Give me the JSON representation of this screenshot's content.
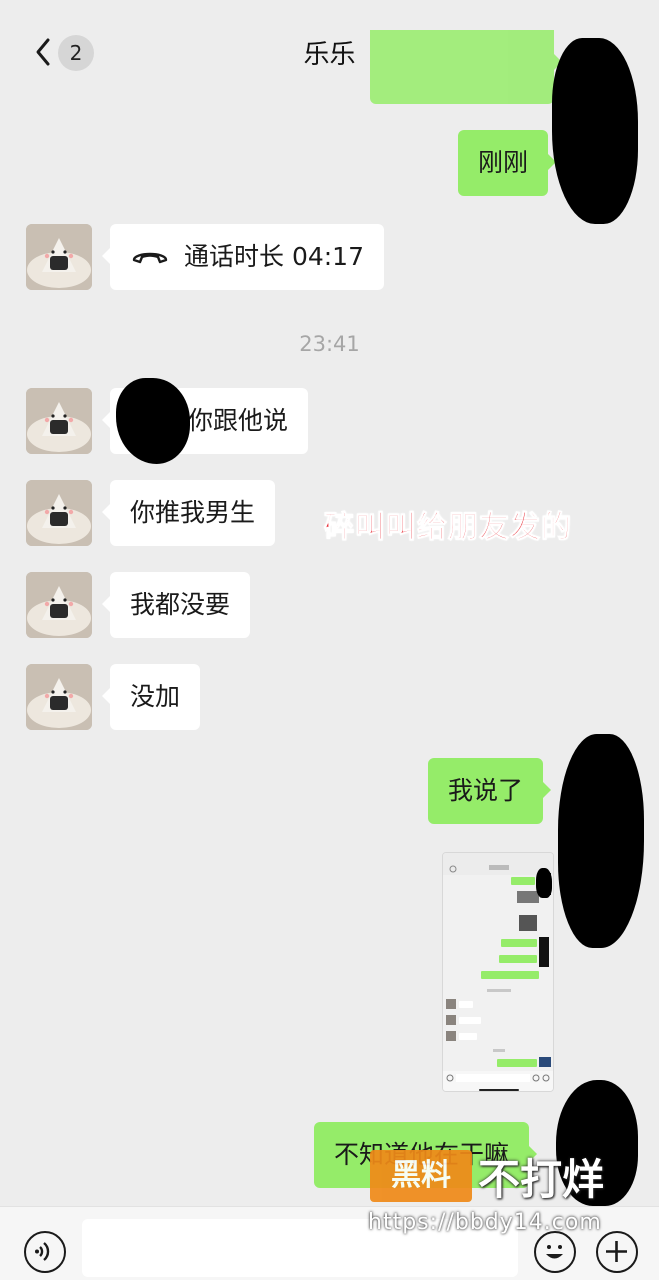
{
  "header": {
    "title": "乐乐",
    "unread_count": "2"
  },
  "messages": {
    "m1": "刚刚",
    "call_label": "通话时长 04:17",
    "timestamp": "23:41",
    "m2": "你跟他说",
    "m3": "你推我男生",
    "m4": "我都没要",
    "m5": "没加",
    "m6": "我说了",
    "m7": "不知道他在干嘛"
  },
  "overlay": {
    "caption": "碎叫叫给朋友发的"
  },
  "watermark": {
    "logo": "黑料",
    "text": "不打烊",
    "url": "https://bbdy14.com"
  },
  "icons": {
    "back": "chevron-left-icon",
    "call": "phone-call-icon",
    "voice": "voice-input-icon",
    "emoji": "emoji-icon",
    "plus": "plus-icon"
  },
  "colors": {
    "outgoing_bubble": "#95ec69",
    "incoming_bubble": "#ffffff",
    "background": "#ededed",
    "caption": "#e8252f",
    "watermark_logo": "#f08a18"
  }
}
